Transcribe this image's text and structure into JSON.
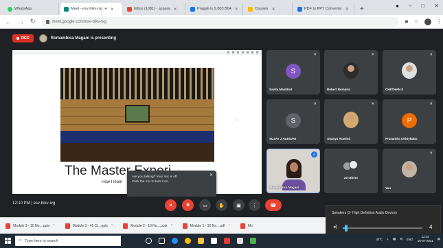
{
  "browser": {
    "tabs": [
      {
        "label": "WhatsApp",
        "color": "#25d366",
        "active": false
      },
      {
        "label": "Meet - esv-bikv-ivg",
        "color": "#00897b",
        "active": true
      },
      {
        "label": "Inbox (1081) - aspara",
        "color": "#ea4335",
        "active": false
      },
      {
        "label": "Pragati in 9.003 B04",
        "color": "#1a73e8",
        "active": false
      },
      {
        "label": "Classes",
        "color": "#fbbc04",
        "active": false
      },
      {
        "label": "PDF to PPT Converter",
        "color": "#1a73e8",
        "active": false
      }
    ],
    "new_tab": "+",
    "url": "meet.google.com/esv-bikv-ivg"
  },
  "meet": {
    "rec_label": "REC",
    "presenting_text": "Romambica Magani is presenting",
    "slide": {
      "title": "The Master Experi",
      "subtitle": "How I learn"
    },
    "tiles": [
      {
        "name": "Savita Mashtod",
        "initial": "S",
        "avatar_color": "#7e57c2",
        "type": "initial"
      },
      {
        "name": "Robert Romario",
        "type": "photo"
      },
      {
        "name": "CHETHAN S",
        "type": "photo"
      },
      {
        "name": "SUJAY J ALEGAVI",
        "initial": "S",
        "avatar_color": "#5f6368",
        "type": "initial"
      },
      {
        "name": "Ananya Aravind",
        "type": "photo"
      },
      {
        "name": "Prasantha Chittybabu",
        "initial": "P",
        "avatar_color": "#ef6c00",
        "type": "initial"
      },
      {
        "name": "Romambica Magani",
        "type": "video"
      },
      {
        "name": "20 others",
        "type": "more"
      },
      {
        "name": "You",
        "type": "photo"
      }
    ],
    "toast": {
      "line1": "Are you talking? Your mic is off.",
      "line2": "Click the mic to turn it on."
    },
    "meeting_time": "12:10 PM",
    "meeting_code": "esv-bikv-ivg"
  },
  "audio": {
    "device": "Speakers (2- High Definition Audio Device)",
    "volume": 4,
    "volume_fraction": 0.04
  },
  "downloads": [
    {
      "label": "Module 3 - 10 No....pptx"
    },
    {
      "label": "Module 3 - 41 (3....pptx"
    },
    {
      "label": "Module 2 - 10 No....pptx"
    },
    {
      "label": "Module 1 - 10 No....pdf"
    },
    {
      "label": "Mo"
    }
  ],
  "taskbar": {
    "search_placeholder": "Type here to search",
    "lang": "ENG",
    "time": "12:10",
    "date": "16-07-2021",
    "weather": "30°C"
  }
}
